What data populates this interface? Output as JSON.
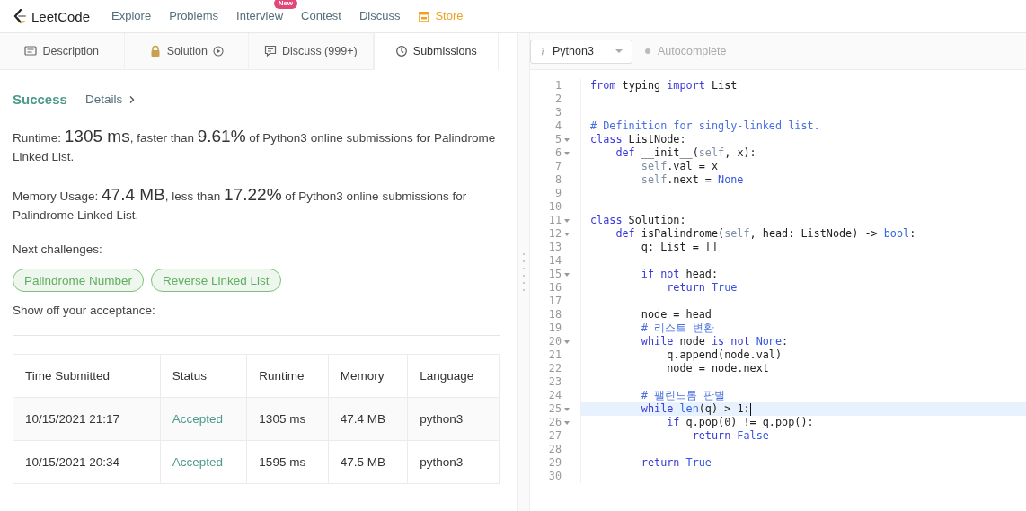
{
  "nav": {
    "brand": "LeetCode",
    "items": [
      {
        "label": "Explore",
        "kind": "link"
      },
      {
        "label": "Problems",
        "kind": "link"
      },
      {
        "label": "Interview",
        "kind": "link",
        "badge": "New"
      },
      {
        "label": "Contest",
        "kind": "link"
      },
      {
        "label": "Discuss",
        "kind": "link"
      },
      {
        "label": "Store",
        "kind": "store"
      }
    ]
  },
  "tabs": [
    {
      "label": "Description",
      "selected": false
    },
    {
      "label": "Solution",
      "selected": false
    },
    {
      "label": "Discuss (999+)",
      "selected": false
    },
    {
      "label": "Submissions",
      "selected": true
    }
  ],
  "result": {
    "status": "Success",
    "details": "Details",
    "runtime": {
      "label": "Runtime:",
      "value": "1305 ms",
      "text_before": ", faster than",
      "percent": "9.61%",
      "text_after": "of Python3 online submissions for Palindrome Linked List."
    },
    "memory": {
      "label": "Memory Usage:",
      "value": "47.4 MB",
      "text_before": ", less than",
      "percent": "17.22%",
      "text_after": "of Python3 online submissions for Palindrome Linked List."
    },
    "next_label": "Next challenges:",
    "challenges": [
      "Palindrome Number",
      "Reverse Linked List"
    ],
    "share_label": "Show off your acceptance:"
  },
  "table": {
    "columns": [
      "Time Submitted",
      "Status",
      "Runtime",
      "Memory",
      "Language"
    ],
    "rows": [
      [
        "10/15/2021 21:17",
        "Accepted",
        "1305 ms",
        "47.4 MB",
        "python3"
      ],
      [
        "10/15/2021 20:34",
        "Accepted",
        "1595 ms",
        "47.5 MB",
        "python3"
      ]
    ]
  },
  "editor": {
    "language": "Python3",
    "autocomplete": {
      "label": "Autocomplete",
      "on": false
    },
    "lines": [
      {
        "number": "1",
        "foldable": false,
        "active": false,
        "tokens": [
          {
            "kind": "kw",
            "text": "from"
          },
          {
            "kind": "plain",
            "text": " typing "
          },
          {
            "kind": "kw",
            "text": "import"
          },
          {
            "kind": "plain",
            "text": " List"
          }
        ]
      },
      {
        "number": "2",
        "foldable": false,
        "active": false
      },
      {
        "number": "3",
        "foldable": false,
        "active": false
      },
      {
        "number": "4",
        "foldable": false,
        "active": false,
        "tokens": [
          {
            "kind": "comment",
            "text": "# Definition for singly-linked list."
          }
        ]
      },
      {
        "number": "5",
        "foldable": true,
        "active": false,
        "tokens": [
          {
            "kind": "kw",
            "text": "class"
          },
          {
            "kind": "plain",
            "text": " ListNode:"
          }
        ]
      },
      {
        "number": "6",
        "foldable": true,
        "active": false,
        "tokens": [
          {
            "kind": "kw",
            "text": "    def"
          },
          {
            "kind": "plain",
            "text": " __init__("
          },
          {
            "kind": "self",
            "text": "self"
          },
          {
            "kind": "plain",
            "text": ", x):"
          }
        ]
      },
      {
        "number": "7",
        "foldable": false,
        "active": false,
        "tokens": [
          {
            "kind": "self",
            "text": "        self"
          },
          {
            "kind": "plain",
            "text": ".val = x"
          }
        ]
      },
      {
        "number": "8",
        "foldable": false,
        "active": false,
        "tokens": [
          {
            "kind": "self",
            "text": "        self"
          },
          {
            "kind": "plain",
            "text": ".next = "
          },
          {
            "kind": "atom",
            "text": "None"
          }
        ]
      },
      {
        "number": "9",
        "foldable": false,
        "active": false
      },
      {
        "number": "10",
        "foldable": false,
        "active": false
      },
      {
        "number": "11",
        "foldable": true,
        "active": false,
        "tokens": [
          {
            "kind": "kw",
            "text": "class"
          },
          {
            "kind": "plain",
            "text": " Solution:"
          }
        ]
      },
      {
        "number": "12",
        "foldable": true,
        "active": false,
        "tokens": [
          {
            "kind": "kw",
            "text": "    def"
          },
          {
            "kind": "plain",
            "text": " isPalindrome("
          },
          {
            "kind": "self",
            "text": "self"
          },
          {
            "kind": "plain",
            "text": ", head: ListNode) -> "
          },
          {
            "kind": "builtin",
            "text": "bool"
          },
          {
            "kind": "plain",
            "text": ":"
          }
        ]
      },
      {
        "number": "13",
        "foldable": false,
        "active": false,
        "tokens": [
          {
            "kind": "plain",
            "text": "        q: List = []"
          }
        ]
      },
      {
        "number": "14",
        "foldable": false,
        "active": false
      },
      {
        "number": "15",
        "foldable": true,
        "active": false,
        "tokens": [
          {
            "kind": "kw",
            "text": "        if not"
          },
          {
            "kind": "plain",
            "text": " head:"
          }
        ]
      },
      {
        "number": "16",
        "foldable": false,
        "active": false,
        "tokens": [
          {
            "kind": "kw",
            "text": "            return"
          },
          {
            "kind": "atom",
            "text": " True"
          }
        ]
      },
      {
        "number": "17",
        "foldable": false,
        "active": false
      },
      {
        "number": "18",
        "foldable": false,
        "active": false,
        "tokens": [
          {
            "kind": "plain",
            "text": "        node = head"
          }
        ]
      },
      {
        "number": "19",
        "foldable": false,
        "active": false,
        "tokens": [
          {
            "kind": "comment",
            "text": "        # 리스트 변환"
          }
        ]
      },
      {
        "number": "20",
        "foldable": true,
        "active": false,
        "tokens": [
          {
            "kind": "kw",
            "text": "        while"
          },
          {
            "kind": "plain",
            "text": " node "
          },
          {
            "kind": "kw",
            "text": "is not"
          },
          {
            "kind": "atom",
            "text": " None"
          },
          {
            "kind": "plain",
            "text": ":"
          }
        ]
      },
      {
        "number": "21",
        "foldable": false,
        "active": false,
        "tokens": [
          {
            "kind": "plain",
            "text": "            q.append(node.val)"
          }
        ]
      },
      {
        "number": "22",
        "foldable": false,
        "active": false,
        "tokens": [
          {
            "kind": "plain",
            "text": "            node = node.next"
          }
        ]
      },
      {
        "number": "23",
        "foldable": false,
        "active": false
      },
      {
        "number": "24",
        "foldable": false,
        "active": false,
        "tokens": [
          {
            "kind": "comment",
            "text": "        # 팰린드롬 판별"
          }
        ]
      },
      {
        "number": "25",
        "foldable": true,
        "active": true,
        "tokens": [
          {
            "kind": "kw",
            "text": "        while"
          },
          {
            "kind": "builtin",
            "text": " len"
          },
          {
            "kind": "plain",
            "text": "(q) > 1:"
          }
        ]
      },
      {
        "number": "26",
        "foldable": true,
        "active": false,
        "tokens": [
          {
            "kind": "kw",
            "text": "            if"
          },
          {
            "kind": "plain",
            "text": " q.pop(0) != q.pop():"
          }
        ]
      },
      {
        "number": "27",
        "foldable": false,
        "active": false,
        "tokens": [
          {
            "kind": "kw",
            "text": "                return"
          },
          {
            "kind": "atom",
            "text": " False"
          }
        ]
      },
      {
        "number": "28",
        "foldable": false,
        "active": false
      },
      {
        "number": "29",
        "foldable": false,
        "active": false,
        "tokens": [
          {
            "kind": "kw",
            "text": "        return"
          },
          {
            "kind": "atom",
            "text": " True"
          }
        ]
      },
      {
        "number": "30",
        "foldable": false,
        "active": false
      }
    ]
  }
}
